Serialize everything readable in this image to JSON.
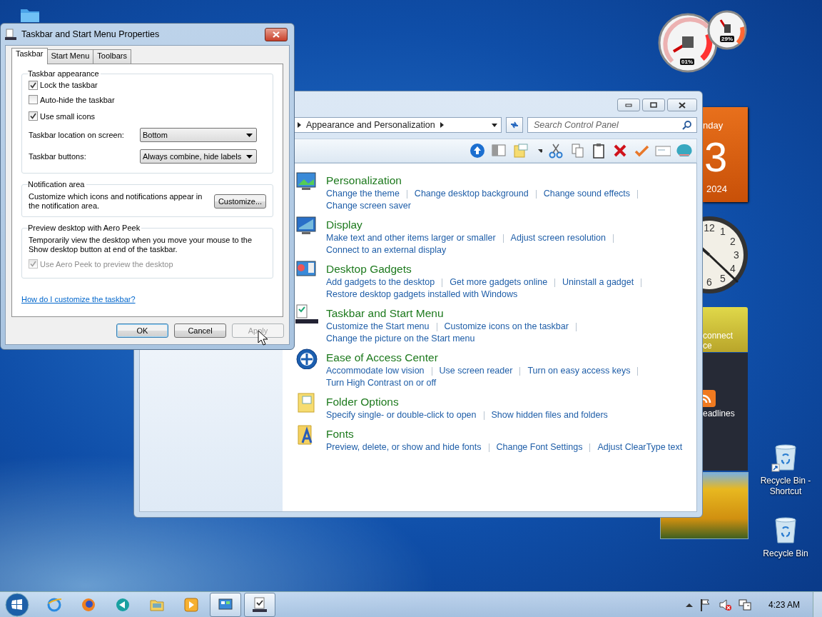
{
  "desktop": {
    "icons": [
      {
        "label": "Recycle Bin - Shortcut",
        "shortcut": true
      },
      {
        "label": "Recycle Bin",
        "shortcut": false
      }
    ]
  },
  "gadgets": {
    "cpu_meter": {
      "cpu": "01%",
      "memory": "29%"
    },
    "calendar": {
      "day_name": "nday",
      "day": "3",
      "year": "2024"
    },
    "clock": {
      "numerals": [
        "12",
        "1",
        "2",
        "3",
        "4",
        "5",
        "6"
      ]
    },
    "weather": {
      "line_1": "connect",
      "line_2": "ce"
    },
    "feed": {
      "title": "eadlines"
    }
  },
  "control_panel": {
    "breadcrumb": "Appearance and Personalization",
    "search": {
      "placeholder": "Search Control Panel"
    },
    "categories": [
      {
        "title": "Personalization",
        "links": [
          [
            "Change the theme",
            "Change desktop background",
            "Change sound effects"
          ],
          [
            "Change screen saver"
          ]
        ]
      },
      {
        "title": "Display",
        "links": [
          [
            "Make text and other items larger or smaller",
            "Adjust screen resolution"
          ],
          [
            "Connect to an external display"
          ]
        ]
      },
      {
        "title": "Desktop Gadgets",
        "links": [
          [
            "Add gadgets to the desktop",
            "Get more gadgets online",
            "Uninstall a gadget"
          ],
          [
            "Restore desktop gadgets installed with Windows"
          ]
        ]
      },
      {
        "title": "Taskbar and Start Menu",
        "links": [
          [
            "Customize the Start menu",
            "Customize icons on the taskbar"
          ],
          [
            "Change the picture on the Start menu"
          ]
        ]
      },
      {
        "title": "Ease of Access Center",
        "links": [
          [
            "Accommodate low vision",
            "Use screen reader",
            "Turn on easy access keys"
          ],
          [
            "Turn High Contrast on or off"
          ]
        ]
      },
      {
        "title": "Folder Options",
        "links": [
          [
            "Specify single- or double-click to open",
            "Show hidden files and folders"
          ]
        ]
      },
      {
        "title": "Fonts",
        "links": [
          [
            "Preview, delete, or show and hide fonts",
            "Change Font Settings",
            "Adjust ClearType text"
          ]
        ]
      }
    ]
  },
  "dialog": {
    "title": "Taskbar and Start Menu Properties",
    "tabs": [
      {
        "label": "Taskbar",
        "selected": true
      },
      {
        "label": "Start Menu",
        "selected": false
      },
      {
        "label": "Toolbars",
        "selected": false
      }
    ],
    "appearance": {
      "heading": "Taskbar appearance",
      "checkboxes": [
        {
          "label": "Lock the taskbar",
          "checked": true,
          "disabled": false
        },
        {
          "label": "Auto-hide the taskbar",
          "checked": false,
          "disabled": false
        },
        {
          "label": "Use small icons",
          "checked": true,
          "disabled": false
        }
      ],
      "dropdowns": [
        {
          "label": "Taskbar location on screen:",
          "value": "Bottom"
        },
        {
          "label": "Taskbar buttons:",
          "value": "Always combine, hide labels"
        }
      ]
    },
    "notification": {
      "heading": "Notification area",
      "text": "Customize which icons and notifications appear in the notification area.",
      "button": "Customize..."
    },
    "peek": {
      "heading": "Preview desktop with Aero Peek",
      "text": "Temporarily view the desktop when you move your mouse to the Show desktop button at end of the taskbar.",
      "checkbox": {
        "label": "Use Aero Peek to preview the desktop",
        "checked": true,
        "disabled": true
      }
    },
    "help_link": "How do I customize the taskbar?",
    "buttons": [
      {
        "label": "OK",
        "default": true,
        "disabled": false
      },
      {
        "label": "Cancel",
        "default": false,
        "disabled": false
      },
      {
        "label": "Apply",
        "default": false,
        "disabled": true
      }
    ]
  },
  "taskbar": {
    "buttons": [
      {
        "open": false
      },
      {
        "open": false
      },
      {
        "open": false
      },
      {
        "open": false
      },
      {
        "open": false
      },
      {
        "open": true
      },
      {
        "open": true
      }
    ],
    "time": "4:23 AM"
  }
}
